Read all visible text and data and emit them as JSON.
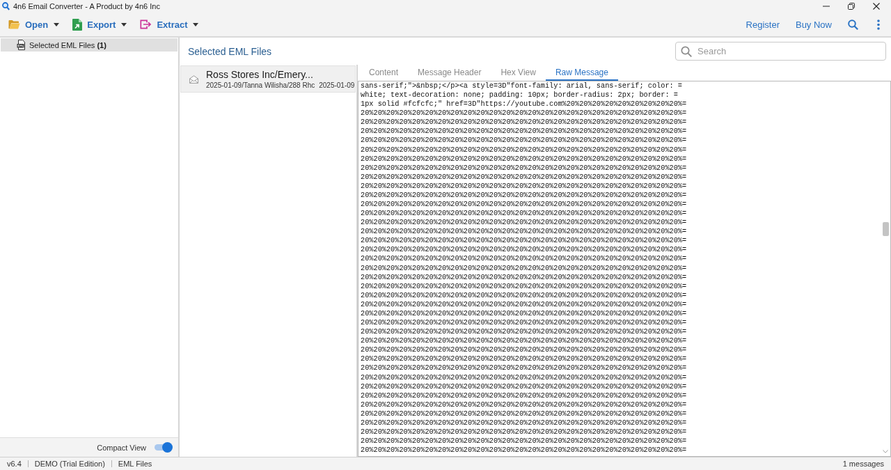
{
  "window": {
    "title": "4n6 Email Converter - A Product by 4n6 Inc"
  },
  "toolbar": {
    "menus": [
      {
        "label": "Open",
        "kind": "open"
      },
      {
        "label": "Export",
        "kind": "export"
      },
      {
        "label": "Extract",
        "kind": "extract"
      }
    ],
    "links": [
      "Register",
      "Buy Now"
    ]
  },
  "sidebar": {
    "items": [
      {
        "label": "Selected EML Files **(1)**",
        "selected": true
      }
    ],
    "compact_view": {
      "label": "Compact View",
      "on": true
    }
  },
  "message_list": {
    "title": "Selected EML Files",
    "search": {
      "placeholder": "Search"
    },
    "messages": [
      {
        "subject": "Ross Stores Inc/Emery...",
        "path": "2025-01-09/Tanna Wilisha/288 Rhc",
        "date": "2025-01-09",
        "selected": true
      }
    ]
  },
  "preview": {
    "tabs": [
      {
        "label": "Content",
        "selected": false
      },
      {
        "label": "Message Header",
        "selected": false
      },
      {
        "label": "Hex View",
        "selected": false
      },
      {
        "label": "Raw Message",
        "selected": true
      }
    ],
    "raw_message": {
      "lines": [
        "sans-serif;\">&nbsp;</p><a style=3D\"font-family: arial, sans-serif; color: =",
        "white; text-decoration: none; padding: 10px; border-radius: 2px; border: =",
        "1px solid #fcfcfc;\" href=3D\"https://youtube.com%20%20%20%20%20%20%20%20%20%=",
        "20%20%20%20%20%20%20%20%20%20%20%20%20%20%20%20%20%20%20%20%20%20%20%20%20%=",
        "20%20%20%20%20%20%20%20%20%20%20%20%20%20%20%20%20%20%20%20%20%20%20%20%20%=",
        "20%20%20%20%20%20%20%20%20%20%20%20%20%20%20%20%20%20%20%20%20%20%20%20%20%=",
        "20%20%20%20%20%20%20%20%20%20%20%20%20%20%20%20%20%20%20%20%20%20%20%20%20%=",
        "20%20%20%20%20%20%20%20%20%20%20%20%20%20%20%20%20%20%20%20%20%20%20%20%20%=",
        "20%20%20%20%20%20%20%20%20%20%20%20%20%20%20%20%20%20%20%20%20%20%20%20%20%=",
        "20%20%20%20%20%20%20%20%20%20%20%20%20%20%20%20%20%20%20%20%20%20%20%20%20%=",
        "20%20%20%20%20%20%20%20%20%20%20%20%20%20%20%20%20%20%20%20%20%20%20%20%20%=",
        "20%20%20%20%20%20%20%20%20%20%20%20%20%20%20%20%20%20%20%20%20%20%20%20%20%=",
        "20%20%20%20%20%20%20%20%20%20%20%20%20%20%20%20%20%20%20%20%20%20%20%20%20%=",
        "20%20%20%20%20%20%20%20%20%20%20%20%20%20%20%20%20%20%20%20%20%20%20%20%20%=",
        "20%20%20%20%20%20%20%20%20%20%20%20%20%20%20%20%20%20%20%20%20%20%20%20%20%=",
        "20%20%20%20%20%20%20%20%20%20%20%20%20%20%20%20%20%20%20%20%20%20%20%20%20%=",
        "20%20%20%20%20%20%20%20%20%20%20%20%20%20%20%20%20%20%20%20%20%20%20%20%20%=",
        "20%20%20%20%20%20%20%20%20%20%20%20%20%20%20%20%20%20%20%20%20%20%20%20%20%=",
        "20%20%20%20%20%20%20%20%20%20%20%20%20%20%20%20%20%20%20%20%20%20%20%20%20%=",
        "20%20%20%20%20%20%20%20%20%20%20%20%20%20%20%20%20%20%20%20%20%20%20%20%20%=",
        "20%20%20%20%20%20%20%20%20%20%20%20%20%20%20%20%20%20%20%20%20%20%20%20%20%=",
        "20%20%20%20%20%20%20%20%20%20%20%20%20%20%20%20%20%20%20%20%20%20%20%20%20%=",
        "20%20%20%20%20%20%20%20%20%20%20%20%20%20%20%20%20%20%20%20%20%20%20%20%20%=",
        "20%20%20%20%20%20%20%20%20%20%20%20%20%20%20%20%20%20%20%20%20%20%20%20%20%=",
        "20%20%20%20%20%20%20%20%20%20%20%20%20%20%20%20%20%20%20%20%20%20%20%20%20%=",
        "20%20%20%20%20%20%20%20%20%20%20%20%20%20%20%20%20%20%20%20%20%20%20%20%20%=",
        "20%20%20%20%20%20%20%20%20%20%20%20%20%20%20%20%20%20%20%20%20%20%20%20%20%=",
        "20%20%20%20%20%20%20%20%20%20%20%20%20%20%20%20%20%20%20%20%20%20%20%20%20%=",
        "20%20%20%20%20%20%20%20%20%20%20%20%20%20%20%20%20%20%20%20%20%20%20%20%20%=",
        "20%20%20%20%20%20%20%20%20%20%20%20%20%20%20%20%20%20%20%20%20%20%20%20%20%=",
        "20%20%20%20%20%20%20%20%20%20%20%20%20%20%20%20%20%20%20%20%20%20%20%20%20%=",
        "20%20%20%20%20%20%20%20%20%20%20%20%20%20%20%20%20%20%20%20%20%20%20%20%20%=",
        "20%20%20%20%20%20%20%20%20%20%20%20%20%20%20%20%20%20%20%20%20%20%20%20%20%=",
        "20%20%20%20%20%20%20%20%20%20%20%20%20%20%20%20%20%20%20%20%20%20%20%20%20%=",
        "20%20%20%20%20%20%20%20%20%20%20%20%20%20%20%20%20%20%20%20%20%20%20%20%20%=",
        "20%20%20%20%20%20%20%20%20%20%20%20%20%20%20%20%20%20%20%20%20%20%20%20%20%=",
        "20%20%20%20%20%20%20%20%20%20%20%20%20%20%20%20%20%20%20%20%20%20%20%20%20%=",
        "20%20%20%20%20%20%20%20%20%20%20%20%20%20%20%20%20%20%20%20%20%20%20%20%20%=",
        "20%20%20%20%20%20%20%20%20%20%20%20%20%20%20%20%20%20%20%20%20%20%20%20%20%=",
        "20%20%20%20%20%20%20%20%20%20%20%20%20%20%20%20%20%20%20%20%20%20%20%20%20%=",
        "20%20%20%20%20%20%20%20%20%20%20%20%20%20%20%20%20%20%20%20%20%20%20%20%20%="
      ]
    }
  },
  "status_bar": {
    "items": [
      "v6.4",
      "DEMO (Trial Edition)",
      "EML Files"
    ],
    "message_count": "1 messages"
  }
}
